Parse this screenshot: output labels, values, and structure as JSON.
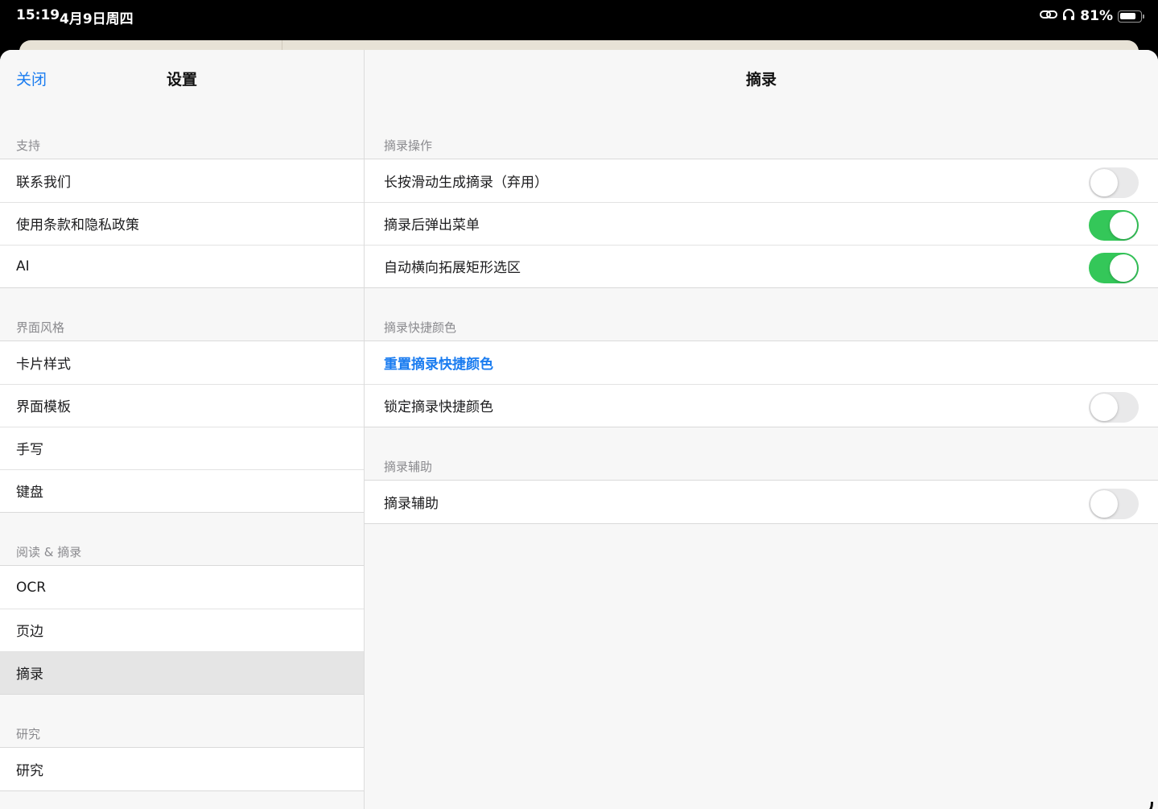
{
  "status_bar": {
    "time": "15:19",
    "date": "4月9日周四",
    "battery": "81%",
    "battery_level": 0.81
  },
  "left": {
    "close_label": "关闭",
    "title": "设置",
    "sections": [
      {
        "header": "支持",
        "items": [
          "联系我们",
          "使用条款和隐私政策",
          "AI"
        ]
      },
      {
        "header": "界面风格",
        "items": [
          "卡片样式",
          "界面模板",
          "手写",
          "键盘"
        ]
      },
      {
        "header": "阅读 & 摘录",
        "items": [
          "OCR",
          "页边",
          "摘录"
        ],
        "selected": "摘录"
      },
      {
        "header": "研究",
        "items": [
          "研究"
        ]
      }
    ]
  },
  "right": {
    "title": "摘录",
    "sections": [
      {
        "header": "摘录操作",
        "rows": [
          {
            "label": "长按滑动生成摘录（弃用）",
            "toggle": false
          },
          {
            "label": "摘录后弹出菜单",
            "toggle": true
          },
          {
            "label": "自动横向拓展矩形选区",
            "toggle": true
          }
        ]
      },
      {
        "header": "摘录快捷颜色",
        "rows": [
          {
            "label": "重置摘录快捷颜色",
            "link": true
          },
          {
            "label": "锁定摘录快捷颜色",
            "toggle": false
          }
        ]
      },
      {
        "header": "摘录辅助",
        "rows": [
          {
            "label": "摘录辅助",
            "toggle": false
          }
        ]
      }
    ]
  },
  "colors": {
    "accent": "#1a7cf0",
    "toggle_on": "#34c759",
    "toggle_off": "#e9e9ea"
  },
  "icons": {
    "status": [
      "link-icon",
      "headphones-icon",
      "battery-icon"
    ]
  }
}
